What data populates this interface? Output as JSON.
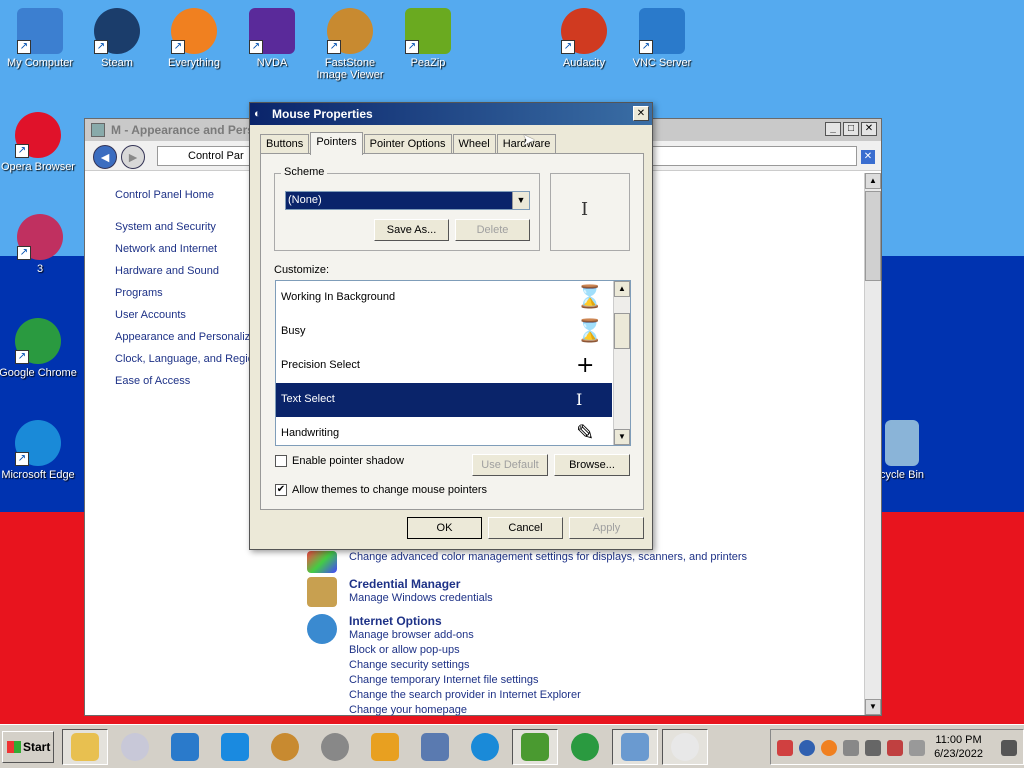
{
  "desktop": {
    "icons": [
      {
        "label": "My Computer",
        "color": "#3c7fd0"
      },
      {
        "label": "Steam",
        "color": "#1b3d6b"
      },
      {
        "label": "Everything",
        "color": "#f08020"
      },
      {
        "label": "NVDA",
        "color": "#5a2a9a"
      },
      {
        "label": "FastStone Image Viewer",
        "color": "#c88a30"
      },
      {
        "label": "PeaZip",
        "color": "#6aaa20"
      },
      {
        "label": "Audacity",
        "color": "#d03a20"
      },
      {
        "label": "VNC Server",
        "color": "#2a7acb"
      },
      {
        "label": "Opera Browser",
        "color": "#e0122a"
      },
      {
        "label": "3",
        "color": "#c03060"
      },
      {
        "label": "Google Chrome",
        "color": "#2a9a40"
      },
      {
        "label": "Microsoft Edge",
        "color": "#1a8ad8"
      },
      {
        "label": "cycle Bin",
        "color": "#8ab4d8"
      }
    ]
  },
  "control_panel": {
    "title": "M - Appearance and Pers",
    "address": "Control Par",
    "nav": {
      "back": "◄",
      "forward": "►"
    },
    "title_buttons": {
      "min": "_",
      "max": "□",
      "close": "✕"
    },
    "clear_address": "✕",
    "sidebar": {
      "home": "Control Panel Home",
      "items": [
        "System and Security",
        "Network and Internet",
        "Hardware and Sound",
        "Programs",
        "User Accounts",
        "Appearance and Personaliza",
        "Clock, Language, and Regio",
        "Ease of Access"
      ]
    },
    "color_mgmt_link": "Change advanced color management settings for displays, scanners, and printers",
    "credential": {
      "heading": "Credential Manager",
      "link": "Manage Windows credentials"
    },
    "internet": {
      "heading": "Internet Options",
      "links": [
        "Manage browser add-ons",
        "Block or allow pop-ups",
        "Change security settings",
        "Change temporary Internet file settings",
        "Change the search provider in Internet Explorer",
        "Change your homepage"
      ]
    }
  },
  "dialog": {
    "title": "Mouse Properties",
    "close": "✕",
    "tabs": [
      "Buttons",
      "Pointers",
      "Pointer Options",
      "Wheel",
      "Hardware"
    ],
    "scheme": {
      "label": "Scheme",
      "value": "(None)",
      "save_as": "Save As...",
      "delete": "Delete"
    },
    "customize_label": "Customize:",
    "pointers": [
      {
        "name": "Working In Background",
        "glyph": "⌛"
      },
      {
        "name": "Busy",
        "glyph": "⌛"
      },
      {
        "name": "Precision Select",
        "glyph": "+"
      },
      {
        "name": "Text Select",
        "glyph": "I"
      },
      {
        "name": "Handwriting",
        "glyph": "✎"
      }
    ],
    "preview_glyph": "I",
    "enable_shadow": "Enable pointer shadow",
    "use_default": "Use Default",
    "browse": "Browse...",
    "allow_themes": "Allow themes to change mouse pointers",
    "ok": "OK",
    "cancel": "Cancel",
    "apply": "Apply"
  },
  "taskbar": {
    "start": "Start",
    "time": "11:00 PM",
    "date": "6/23/2022"
  }
}
